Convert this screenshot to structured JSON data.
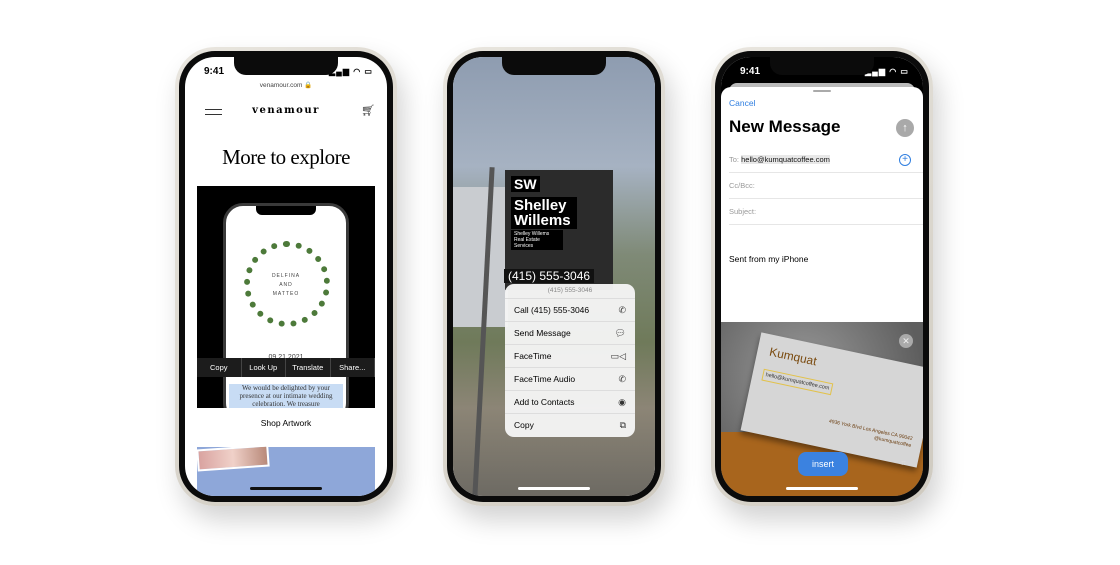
{
  "phone1": {
    "status_time": "9:41",
    "url": "venamour.com 🔒",
    "logo": "venamour",
    "heading": "More to explore",
    "invite_names": [
      "DELFINA",
      "AND",
      "MATTEO"
    ],
    "invite_date": "09.21.2021",
    "context_menu": [
      "Copy",
      "Look Up",
      "Translate",
      "Share..."
    ],
    "selected_text": "We would be delighted by your presence at our intimate wedding celebration. We treasure",
    "link": "Shop Artwork"
  },
  "phone2": {
    "sign_initials": "SW",
    "sign_name": "Shelley Willems",
    "sign_sub": "Shelley Willems Real Estate Services",
    "sign_phone": "(415) 555-3046",
    "menu_header": "(415) 555-3046",
    "menu_items": [
      {
        "label": "Call (415) 555-3046",
        "icon": "phone-icon"
      },
      {
        "label": "Send Message",
        "icon": "message-icon"
      },
      {
        "label": "FaceTime",
        "icon": "video-icon"
      },
      {
        "label": "FaceTime Audio",
        "icon": "phone-icon"
      },
      {
        "label": "Add to Contacts",
        "icon": "add-contact-icon"
      },
      {
        "label": "Copy",
        "icon": "copy-icon"
      }
    ]
  },
  "phone3": {
    "status_time": "9:41",
    "cancel": "Cancel",
    "title": "New Message",
    "to_label": "To:",
    "to_value": "hello@kumquatcoffee.com",
    "cc_label": "Cc/Bcc:",
    "subject_label": "Subject:",
    "body": "Sent from my iPhone",
    "card_name": "Kumquat",
    "card_email": "hello@kumquatcoffee.com",
    "card_address": "4936 York Blvd Los Angeles CA 90042",
    "card_handle": "@kumquatcoffee",
    "insert": "insert",
    "accent": "#2f7ee0"
  }
}
